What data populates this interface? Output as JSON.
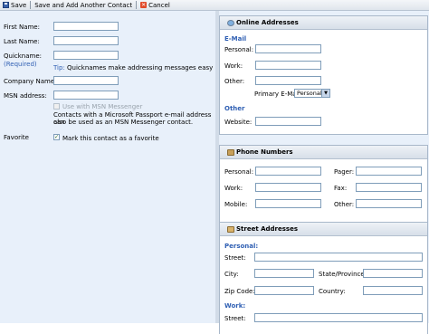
{
  "toolbar": {
    "save": "Save",
    "save_add": "Save and Add Another Contact",
    "cancel": "Cancel"
  },
  "form": {
    "first_name": "First Name:",
    "last_name": "Last Name:",
    "quickname": "Quickname:",
    "required": "(Required)",
    "tip_word": "Tip:",
    "tip_text": " Quicknames make addressing messages easy",
    "company_name": "Company Name:",
    "msn_address": "MSN address:",
    "use_msn": "Use with MSN Messenger",
    "msn_note_1": "Contacts with a Microsoft Passport e-mail address can",
    "msn_note_2": "also be used as an MSN Messenger contact.",
    "favorite": "Favorite",
    "favorite_check": "Mark this contact as a favorite"
  },
  "online": {
    "title": "Online Addresses",
    "email_heading": "E-Mail",
    "personal": "Personal:",
    "work": "Work:",
    "other": "Other:",
    "primary_email": "Primary E-Mail",
    "primary_value": "Personal",
    "other_heading": "Other",
    "website": "Website:"
  },
  "phone": {
    "title": "Phone Numbers",
    "personal": "Personal:",
    "work": "Work:",
    "mobile": "Mobile:",
    "pager": "Pager:",
    "fax": "Fax:",
    "other": "Other:"
  },
  "street": {
    "title": "Street Addresses",
    "personal_heading": "Personal:",
    "street": "Street:",
    "city": "City:",
    "state": "State/Province:",
    "zip": "Zip Code:",
    "country": "Country:",
    "work_heading": "Work:",
    "street2": "Street:"
  }
}
